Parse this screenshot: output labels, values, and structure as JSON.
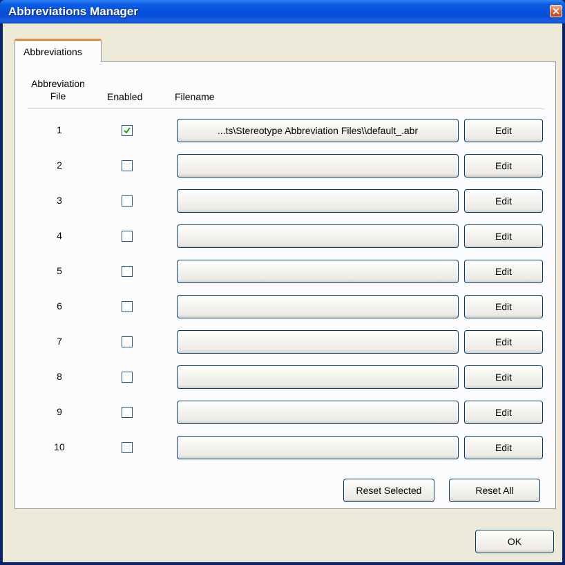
{
  "window": {
    "title": "Abbreviations Manager"
  },
  "tabs": [
    {
      "label": "Abbreviations",
      "active": true
    }
  ],
  "columns": {
    "abbreviation_file": "Abbreviation\nFile",
    "enabled": "Enabled",
    "filename": "Filename"
  },
  "rows": [
    {
      "number": "1",
      "enabled": true,
      "filename": "...ts\\Stereotype Abbreviation Files\\\\default_.abr",
      "edit_label": "Edit"
    },
    {
      "number": "2",
      "enabled": false,
      "filename": "",
      "edit_label": "Edit"
    },
    {
      "number": "3",
      "enabled": false,
      "filename": "",
      "edit_label": "Edit"
    },
    {
      "number": "4",
      "enabled": false,
      "filename": "",
      "edit_label": "Edit"
    },
    {
      "number": "5",
      "enabled": false,
      "filename": "",
      "edit_label": "Edit"
    },
    {
      "number": "6",
      "enabled": false,
      "filename": "",
      "edit_label": "Edit"
    },
    {
      "number": "7",
      "enabled": false,
      "filename": "",
      "edit_label": "Edit"
    },
    {
      "number": "8",
      "enabled": false,
      "filename": "",
      "edit_label": "Edit"
    },
    {
      "number": "9",
      "enabled": false,
      "filename": "",
      "edit_label": "Edit"
    },
    {
      "number": "10",
      "enabled": false,
      "filename": "",
      "edit_label": "Edit"
    }
  ],
  "buttons": {
    "reset_selected": "Reset Selected",
    "reset_all": "Reset All",
    "ok": "OK"
  },
  "colors": {
    "title_bar": "#0a4fd7",
    "dialog_bg": "#ece9d8",
    "panel_bg": "#fcfcfe",
    "tab_accent": "#e68b2c",
    "checkmark": "#21a121",
    "button_border": "#003c74"
  }
}
